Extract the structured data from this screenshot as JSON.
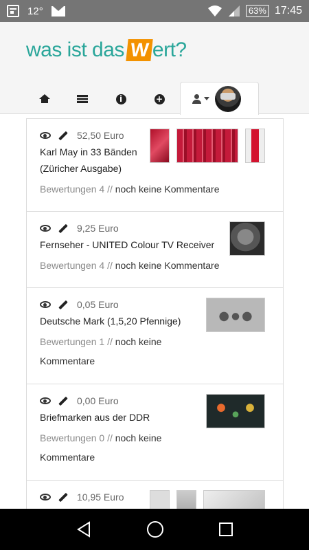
{
  "statusbar": {
    "day": "12",
    "degree": "°",
    "battery": "63%",
    "time": "17:45"
  },
  "logo": {
    "part1": "was ist das",
    "part2": "ert?"
  },
  "items": [
    {
      "price": "52,50 Euro",
      "title_line1": "Karl May in 33 Bänden",
      "title_line2": "(Züricher Ausgabe)",
      "bewertungen": "Bewertungen 4 //",
      "kommentare": "noch keine Kommentare"
    },
    {
      "price": "9,25 Euro",
      "title_line1": "Fernseher - UNITED Colour TV Receiver",
      "bewertungen": "Bewertungen 4 //",
      "kommentare": "noch keine Kommentare"
    },
    {
      "price": "0,05 Euro",
      "title_line1": "Deutsche Mark (1,5,20 Pfennige)",
      "bewertungen": "Bewertungen 1 //",
      "kommentare": "noch keine",
      "kommentare2": "Kommentare"
    },
    {
      "price": "0,00 Euro",
      "title_line1": "Briefmarken aus der DDR",
      "bewertungen": "Bewertungen 0 //",
      "kommentare": "noch keine",
      "kommentare2": "Kommentare"
    },
    {
      "price": "10,95 Euro"
    }
  ]
}
